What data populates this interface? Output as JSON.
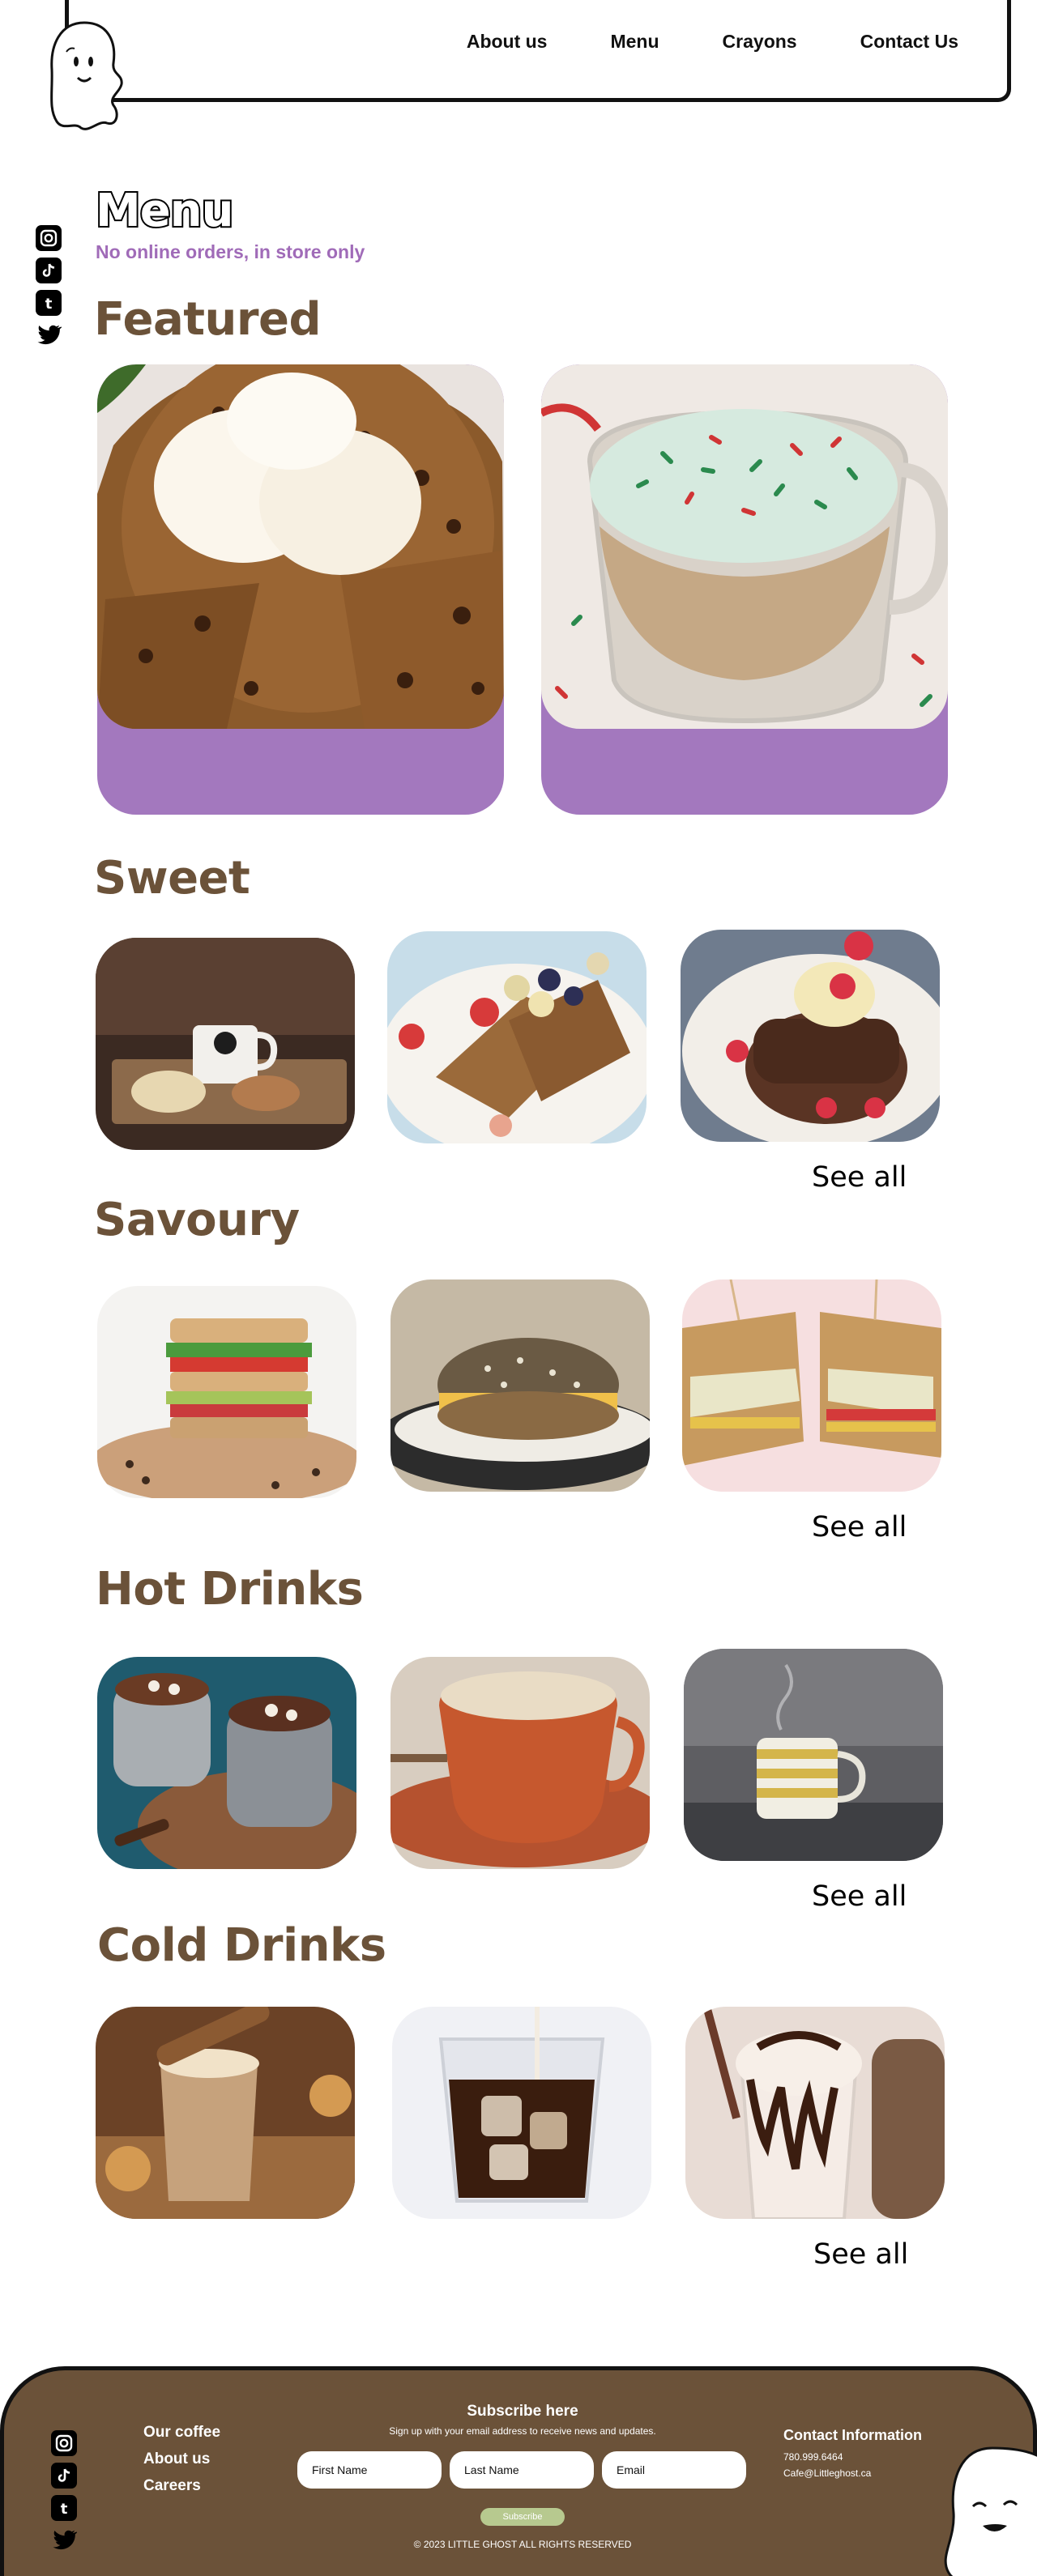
{
  "nav": {
    "items": [
      "About us",
      "Menu",
      "Crayons",
      "Contact Us"
    ]
  },
  "page": {
    "title": "Menu",
    "subtitle": "No online orders, in store only"
  },
  "sections": {
    "featured": {
      "title": "Featured",
      "items": [
        "cookie-skillet-ice-cream",
        "peppermint-latte-sprinkles"
      ]
    },
    "sweet": {
      "title": "Sweet",
      "see_all": "See all",
      "items": [
        "cookies-and-mug",
        "french-toast-berries",
        "chocolate-pancakes"
      ]
    },
    "savoury": {
      "title": "Savoury",
      "see_all": "See all",
      "items": [
        "club-sandwich",
        "everything-bagel",
        "sliced-sandwich"
      ]
    },
    "hot_drinks": {
      "title": "Hot Drinks",
      "see_all": "See all",
      "items": [
        "hot-chocolates",
        "orange-cup-coffee",
        "striped-mug"
      ]
    },
    "cold_drinks": {
      "title": "Cold Drinks",
      "see_all": "See all",
      "items": [
        "iced-chai",
        "iced-coffee",
        "chocolate-milkshake"
      ]
    }
  },
  "social": {
    "icons": [
      "instagram-icon",
      "tiktok-icon",
      "tumblr-icon",
      "twitter-icon"
    ]
  },
  "footer": {
    "links": [
      "Our coffee",
      "About us",
      "Careers"
    ],
    "subscribe_title": "Subscribe here",
    "subscribe_desc": "Sign up with your email address to receive news and updates.",
    "fields": {
      "first_name": "First Name",
      "last_name": "Last Name",
      "email": "Email"
    },
    "subscribe_button": "Subscribe",
    "copyright": "© 2023 LITTLE GHOST ALL RIGHTS RESERVED",
    "contact": {
      "heading": "Contact Information",
      "phone": "780.999.6464",
      "email": "Cafe@Littleghost.ca"
    }
  },
  "colors": {
    "accent_purple": "#a378be",
    "subtitle_purple": "#a06bb8",
    "brown": "#6b5239",
    "subscribe_green": "#b7c98f"
  }
}
